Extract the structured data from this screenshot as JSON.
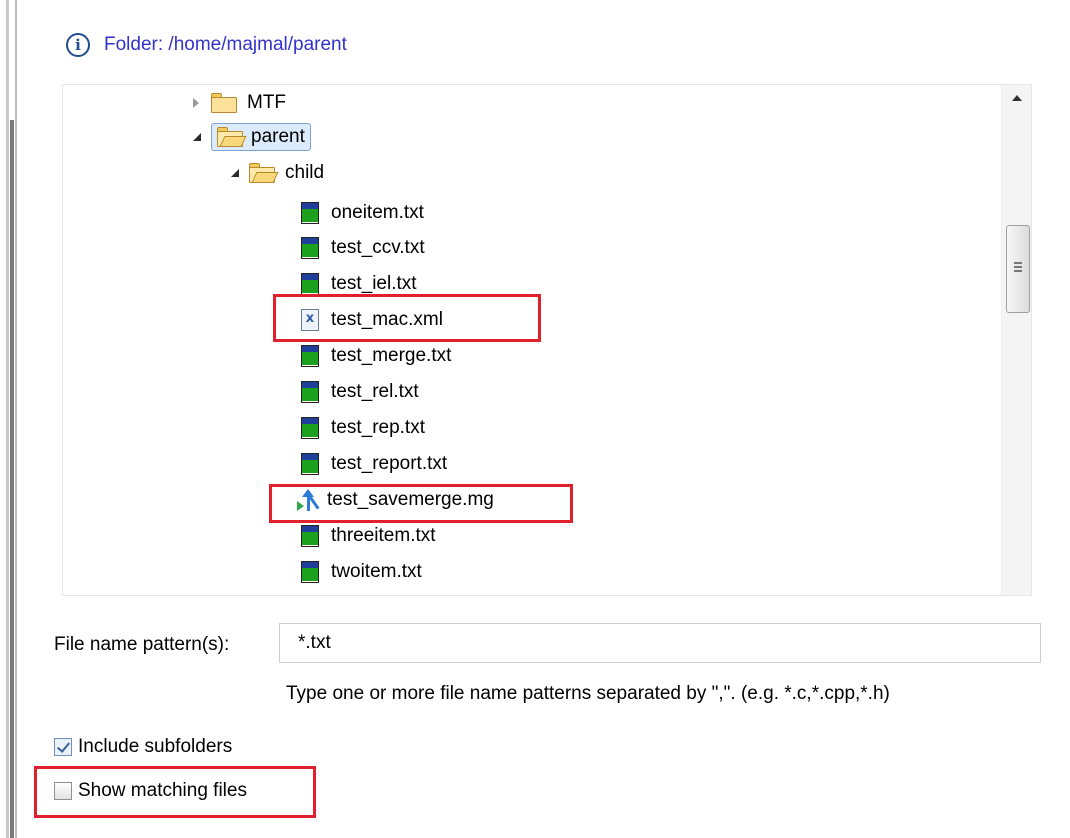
{
  "info": {
    "text": "Folder: /home/majmal/parent"
  },
  "tree": {
    "items": [
      {
        "label": "MTF",
        "kind": "folder",
        "state": "collapsed"
      },
      {
        "label": "parent",
        "kind": "folder",
        "state": "expanded",
        "selected": true
      },
      {
        "label": "child",
        "kind": "folder",
        "state": "expanded"
      },
      {
        "label": "oneitem.txt",
        "kind": "txt"
      },
      {
        "label": "test_ccv.txt",
        "kind": "txt"
      },
      {
        "label": "test_iel.txt",
        "kind": "txt"
      },
      {
        "label": "test_mac.xml",
        "kind": "xml",
        "highlighted": true
      },
      {
        "label": "test_merge.txt",
        "kind": "txt"
      },
      {
        "label": "test_rel.txt",
        "kind": "txt"
      },
      {
        "label": "test_rep.txt",
        "kind": "txt"
      },
      {
        "label": "test_report.txt",
        "kind": "txt"
      },
      {
        "label": "test_savemerge.mg",
        "kind": "mg",
        "highlighted": true
      },
      {
        "label": "threeitem.txt",
        "kind": "txt"
      },
      {
        "label": "twoitem.txt",
        "kind": "txt"
      }
    ]
  },
  "pattern": {
    "label": "File name pattern(s):",
    "value": "*.txt",
    "hint": "Type one or more file name patterns separated by \",\".  (e.g. *.c,*.cpp,*.h)"
  },
  "options": {
    "include_subfolders": {
      "label": "Include subfolders",
      "checked": true
    },
    "show_matching": {
      "label": "Show matching files",
      "checked": false,
      "highlighted": true
    }
  },
  "colors": {
    "highlight": "#e0202a",
    "info_text": "#3333cc",
    "selection": "#dcebfc"
  }
}
